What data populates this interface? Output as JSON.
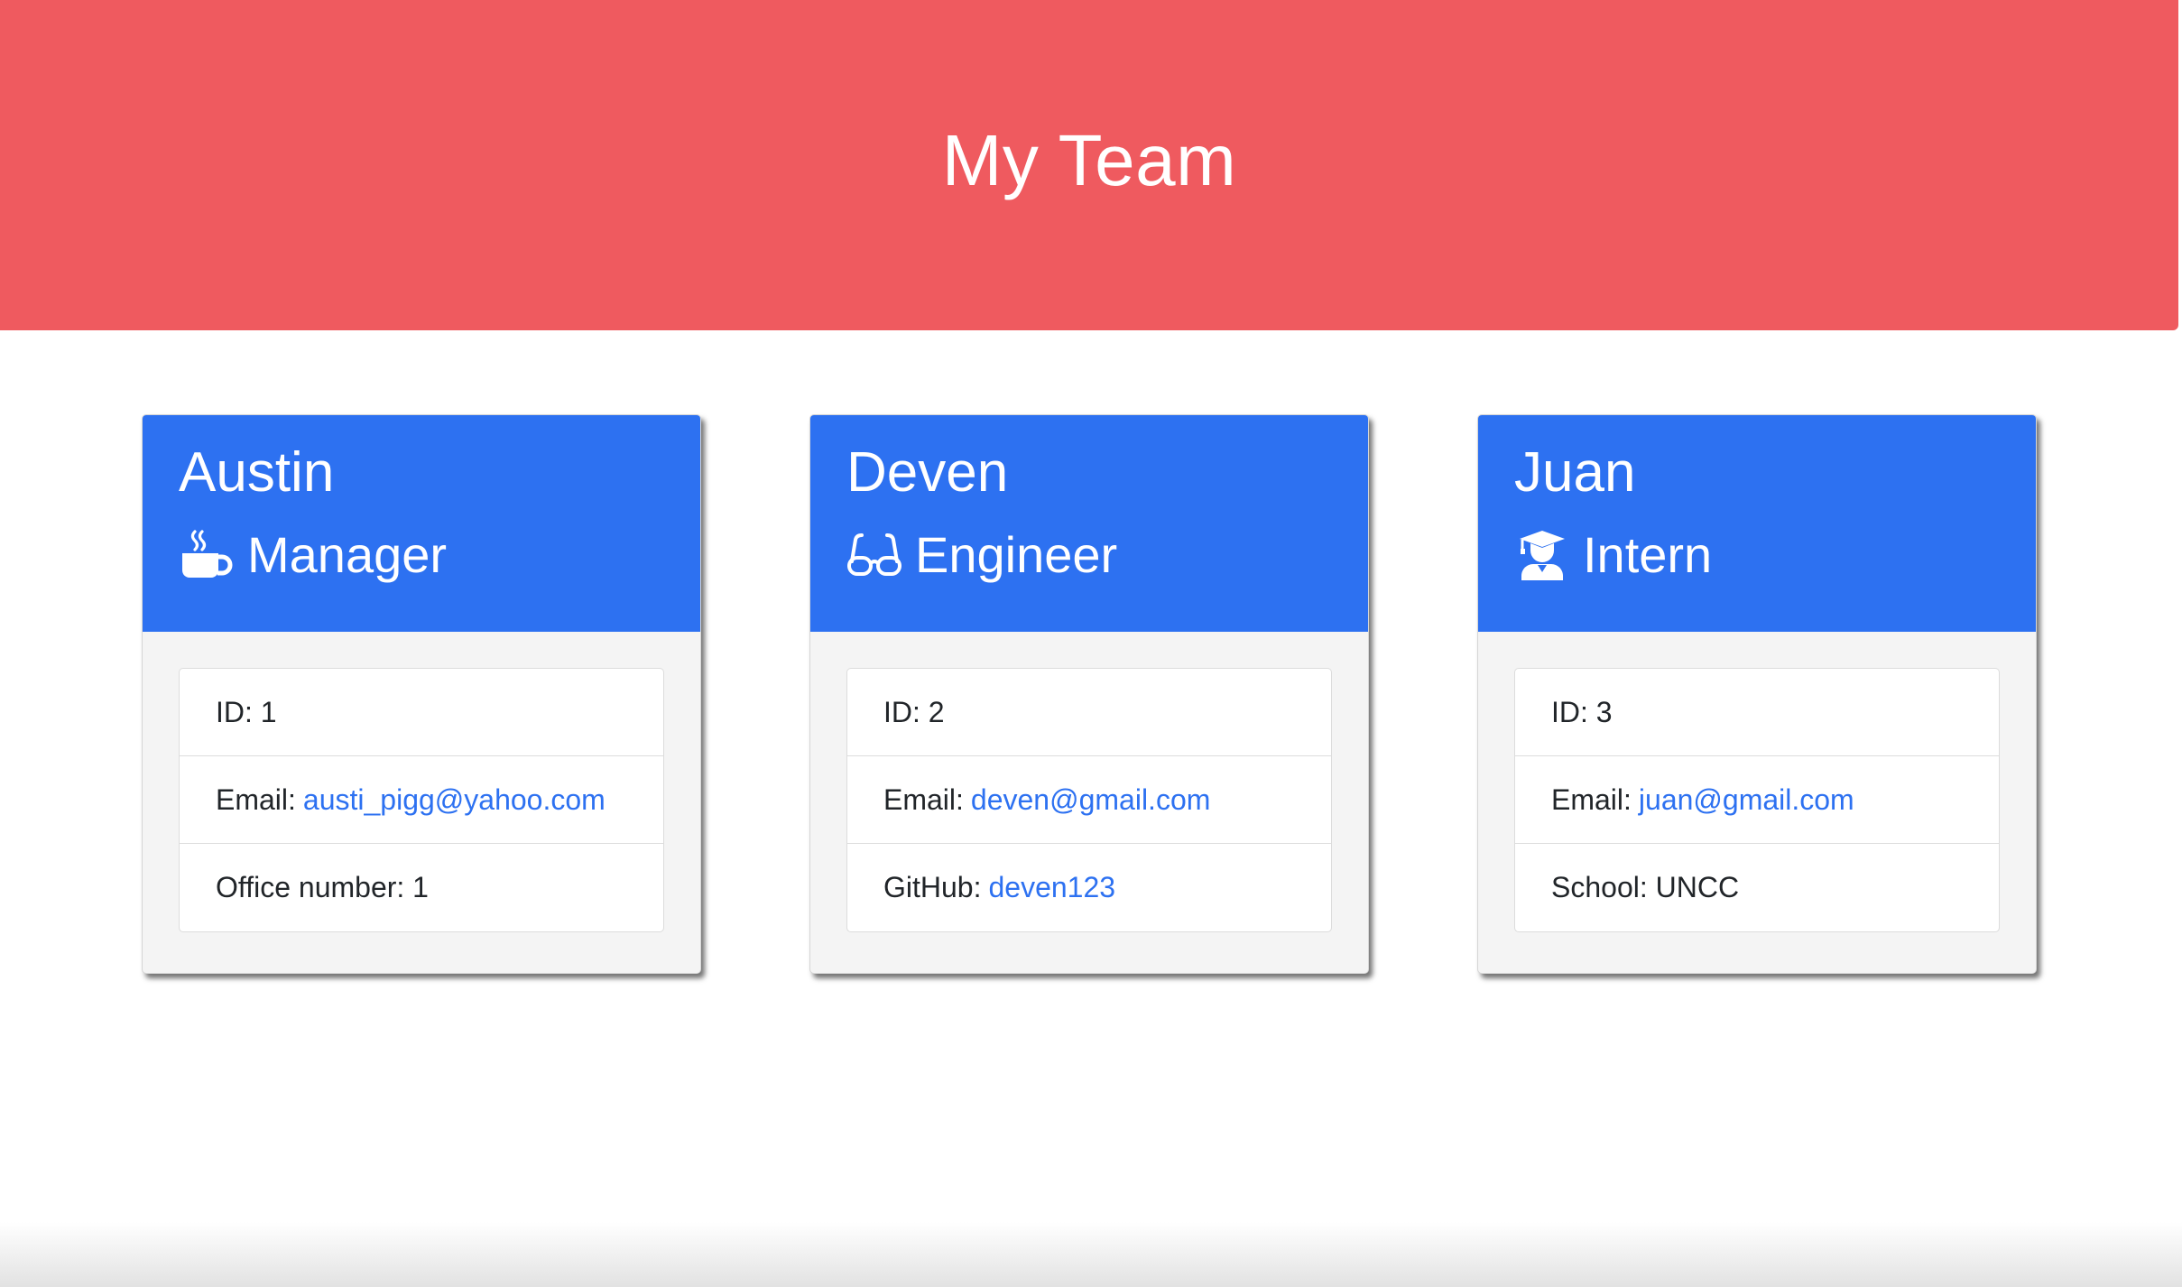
{
  "header": {
    "title": "My Team"
  },
  "colors": {
    "header_bg": "#ef5a5f",
    "card_header_bg": "#2d71f1",
    "link": "#2d71f1"
  },
  "team": [
    {
      "name": "Austin",
      "role": "Manager",
      "icon": "coffee-mug-icon",
      "id_label": "ID:",
      "id_value": "1",
      "email_label": "Email:",
      "email": "austi_pigg@yahoo.com",
      "extra_label": "Office number:",
      "extra_value": "1"
    },
    {
      "name": "Deven",
      "role": "Engineer",
      "icon": "glasses-icon",
      "id_label": "ID:",
      "id_value": "2",
      "email_label": "Email:",
      "email": "deven@gmail.com",
      "extra_label": "GitHub:",
      "extra_value": "deven123"
    },
    {
      "name": "Juan",
      "role": "Intern",
      "icon": "graduate-icon",
      "id_label": "ID:",
      "id_value": "3",
      "email_label": "Email:",
      "email": "juan@gmail.com",
      "extra_label": "School:",
      "extra_value": "UNCC"
    }
  ]
}
